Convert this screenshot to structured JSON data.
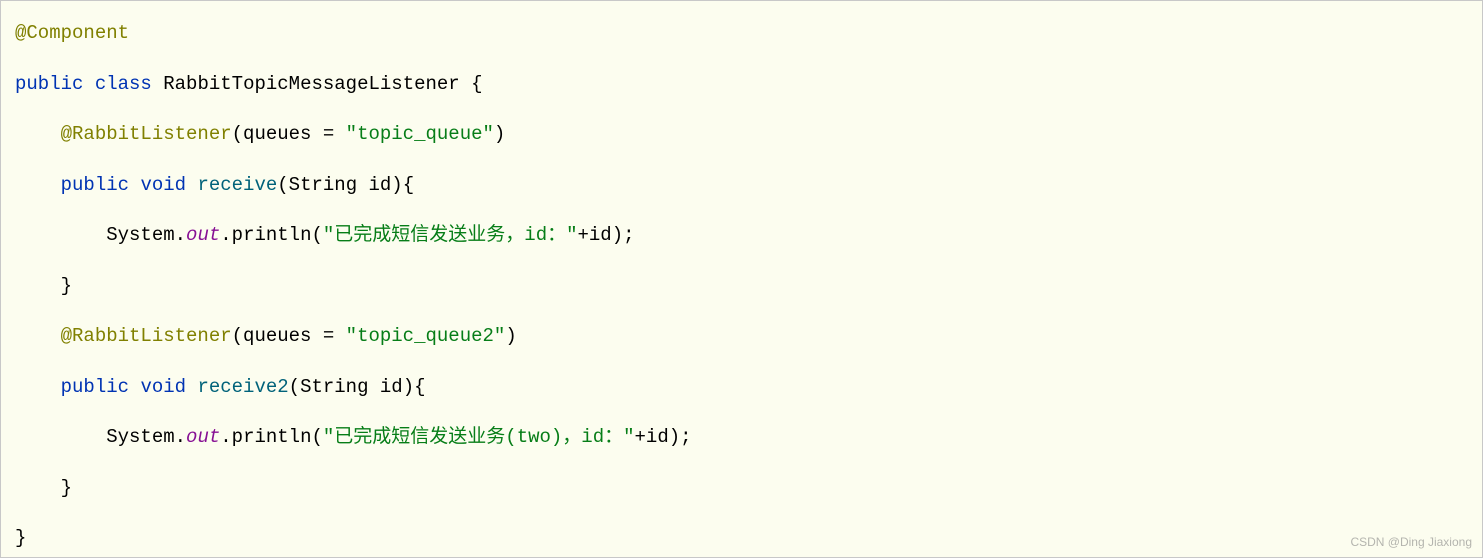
{
  "code": {
    "tokens": [
      {
        "line": 1,
        "indent": 0,
        "parts": [
          {
            "cls": "anno",
            "t": "@Component"
          }
        ]
      },
      {
        "line": 2,
        "indent": 0,
        "parts": [
          {
            "cls": "keyword",
            "t": "public"
          },
          {
            "cls": "punc",
            "t": " "
          },
          {
            "cls": "keyword",
            "t": "class"
          },
          {
            "cls": "punc",
            "t": " "
          },
          {
            "cls": "class-name",
            "t": "RabbitTopicMessageListener"
          },
          {
            "cls": "punc",
            "t": " {"
          }
        ]
      },
      {
        "line": 3,
        "indent": 1,
        "parts": [
          {
            "cls": "anno",
            "t": "@RabbitListener"
          },
          {
            "cls": "punc",
            "t": "(queues = "
          },
          {
            "cls": "string",
            "t": "\"topic_queue\""
          },
          {
            "cls": "punc",
            "t": ")"
          }
        ]
      },
      {
        "line": 4,
        "indent": 1,
        "parts": [
          {
            "cls": "keyword",
            "t": "public"
          },
          {
            "cls": "punc",
            "t": " "
          },
          {
            "cls": "keyword",
            "t": "void"
          },
          {
            "cls": "punc",
            "t": " "
          },
          {
            "cls": "method-decl",
            "t": "receive"
          },
          {
            "cls": "punc",
            "t": "(String id){"
          }
        ]
      },
      {
        "line": 5,
        "indent": 2,
        "parts": [
          {
            "cls": "iden",
            "t": "System."
          },
          {
            "cls": "static-field",
            "t": "out"
          },
          {
            "cls": "iden",
            "t": ".println("
          },
          {
            "cls": "string",
            "t": "\"已完成短信发送业务，id：\""
          },
          {
            "cls": "punc",
            "t": "+id);"
          }
        ]
      },
      {
        "line": 6,
        "indent": 1,
        "parts": [
          {
            "cls": "punc",
            "t": "}"
          }
        ]
      },
      {
        "line": 7,
        "indent": 1,
        "parts": [
          {
            "cls": "anno",
            "t": "@RabbitListener"
          },
          {
            "cls": "punc",
            "t": "(queues = "
          },
          {
            "cls": "string",
            "t": "\"topic_queue2\""
          },
          {
            "cls": "punc",
            "t": ")"
          }
        ]
      },
      {
        "line": 8,
        "indent": 1,
        "parts": [
          {
            "cls": "keyword",
            "t": "public"
          },
          {
            "cls": "punc",
            "t": " "
          },
          {
            "cls": "keyword",
            "t": "void"
          },
          {
            "cls": "punc",
            "t": " "
          },
          {
            "cls": "method-decl",
            "t": "receive2"
          },
          {
            "cls": "punc",
            "t": "(String id){"
          }
        ]
      },
      {
        "line": 9,
        "indent": 2,
        "parts": [
          {
            "cls": "iden",
            "t": "System."
          },
          {
            "cls": "static-field",
            "t": "out"
          },
          {
            "cls": "iden",
            "t": ".println("
          },
          {
            "cls": "string",
            "t": "\"已完成短信发送业务(two)，id：\""
          },
          {
            "cls": "punc",
            "t": "+id);"
          }
        ]
      },
      {
        "line": 10,
        "indent": 1,
        "parts": [
          {
            "cls": "punc",
            "t": "}"
          }
        ]
      },
      {
        "line": 11,
        "indent": 0,
        "parts": [
          {
            "cls": "punc",
            "t": "}"
          }
        ]
      }
    ],
    "indent_unit": "    "
  },
  "watermark": "CSDN @Ding Jiaxiong"
}
